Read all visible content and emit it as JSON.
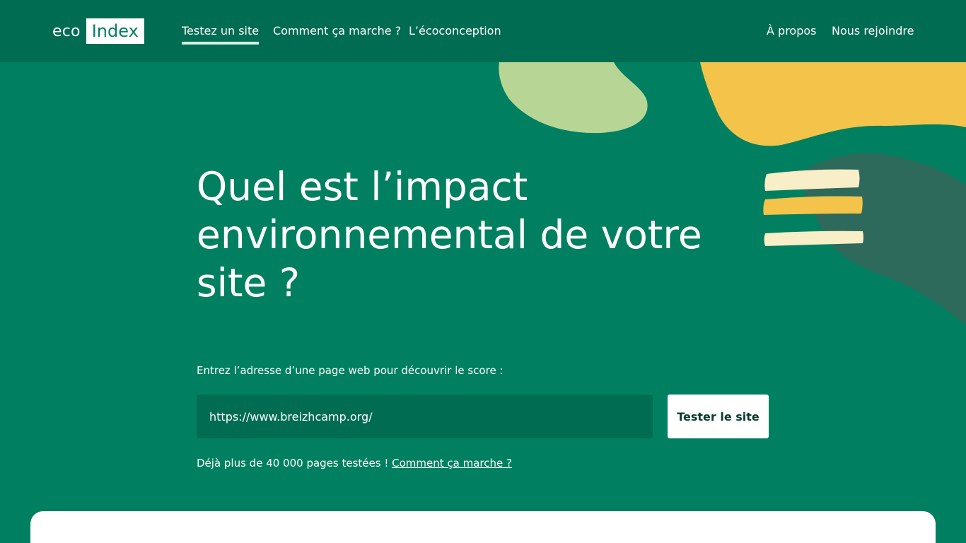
{
  "header": {
    "logo": {
      "eco": "eco",
      "index": "Index"
    },
    "nav": [
      {
        "label": "Testez un site",
        "active": true
      },
      {
        "label": "Comment ça marche ?"
      },
      {
        "label": "L’écoconception"
      }
    ],
    "nav_right": [
      {
        "label": "À propos"
      },
      {
        "label": "Nous rejoindre"
      }
    ]
  },
  "hero": {
    "title": "Quel est l’impact environnemental de votre site ?",
    "prompt": "Entrez l’adresse d’une page web pour découvrir le score :",
    "url_value": "https://www.breizhcamp.org/",
    "submit_label": "Tester le site",
    "stats_text": "Déjà plus de 40 000 pages testées ! ",
    "stats_link": "Comment ça marche ?"
  },
  "colors": {
    "background": "#008060",
    "header": "#006c52",
    "input": "#006c52",
    "blob_light_green": "#b7d595",
    "blob_yellow": "#f3c449",
    "blob_dark": "#2e6a5b",
    "stripe_cream": "#f8eec7",
    "stripe_yellow": "#f3c449"
  }
}
